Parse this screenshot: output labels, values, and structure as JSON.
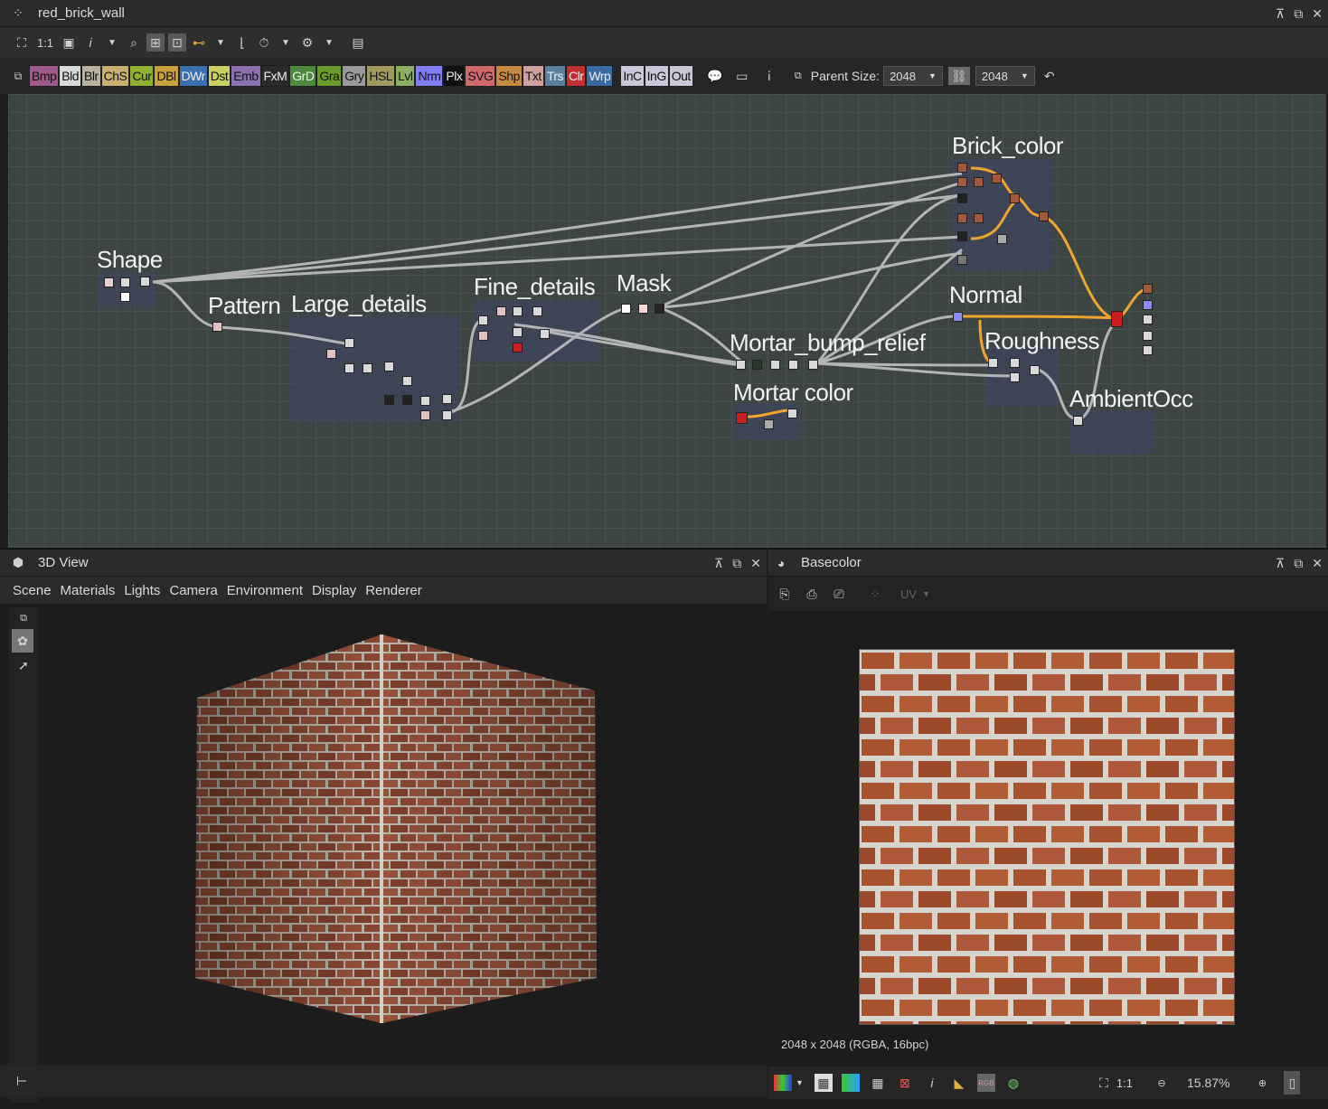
{
  "graph_window": {
    "title": "red_brick_wall",
    "toolbar_zoom_label": "1:1",
    "toolbar_info_label": "i",
    "node_tags": [
      "Bmp",
      "Bld",
      "Blr",
      "ChS",
      "Cur",
      "DBl",
      "DWr",
      "Dst",
      "Emb",
      "FxM",
      "GrD",
      "Gra",
      "Gry",
      "HSL",
      "Lvl",
      "Nrm",
      "Plx",
      "SVG",
      "Shp",
      "Txt",
      "Trs",
      "Clr",
      "Wrp"
    ],
    "io_tags": [
      "InC",
      "InG",
      "Out"
    ],
    "parent_size_label": "Parent Size:",
    "parent_size_value": "2048",
    "second_size_value": "2048",
    "frames": {
      "shape": "Shape",
      "pattern": "Pattern",
      "large_details": "Large_details",
      "fine_details": "Fine_details",
      "mask": "Mask",
      "brick_color": "Brick_color",
      "normal": "Normal",
      "mortar_bump_relief": "Mortar_bump_relief",
      "roughness": "Roughness",
      "mortar_color": "Mortar color",
      "ambient_occ": "AmbientOcc"
    },
    "colors": {
      "canvas": "#3c4542",
      "wire": "#c8c8c8",
      "active_wire": "#f0a430",
      "frame": "#3e4468"
    }
  },
  "view3d": {
    "title": "3D View",
    "menu": [
      "Scene",
      "Materials",
      "Lights",
      "Camera",
      "Environment",
      "Display",
      "Renderer"
    ]
  },
  "basecolor": {
    "title": "Basecolor",
    "uv_label": "UV",
    "info": "2048 x 2048 (RGBA, 16bpc)",
    "zoom_ratio": "1:1",
    "zoom_percent": "15.87%"
  }
}
